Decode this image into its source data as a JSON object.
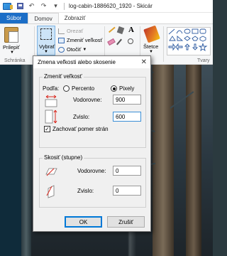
{
  "window": {
    "title": "log-cabin-1886620_1920 - Skicár"
  },
  "tabs": [
    {
      "label": "Súbor"
    },
    {
      "label": "Domov"
    },
    {
      "label": "Zobraziť"
    }
  ],
  "ribbon": {
    "clipboard": {
      "paste_label": "Prilepiť",
      "group_label": "Schránka"
    },
    "image": {
      "select_label": "Vybrať",
      "crop_label": "Orezať",
      "resize_label": "Zmeniť veľkosť",
      "rotate_label": "Otočiť"
    },
    "brushes_label": "Štetce",
    "shapes_group_label": "Tvary"
  },
  "dialog": {
    "title": "Zmena veľkosti alebo skosenie",
    "resize_section": "Zmeniť veľkosť",
    "by_label": "Podľa:",
    "percent_label": "Percento",
    "pixels_label": "Pixely",
    "horizontal_label": "Vodorovne:",
    "horizontal_value": "900",
    "vertical_label": "Zvislo:",
    "vertical_value": "600",
    "keep_ratio_label": "Zachovať pomer strán",
    "skew_section": "Skosiť (stupne)",
    "skew_horizontal_label": "Vodorovne:",
    "skew_horizontal_value": "0",
    "skew_vertical_label": "Zvislo:",
    "skew_vertical_value": "0",
    "ok_label": "OK",
    "cancel_label": "Zrušiť",
    "selected_unit": "Pixely",
    "keep_ratio_checked": true
  },
  "colors": {
    "accent": "#1c6ec7",
    "arrow_red": "#d9281e"
  }
}
